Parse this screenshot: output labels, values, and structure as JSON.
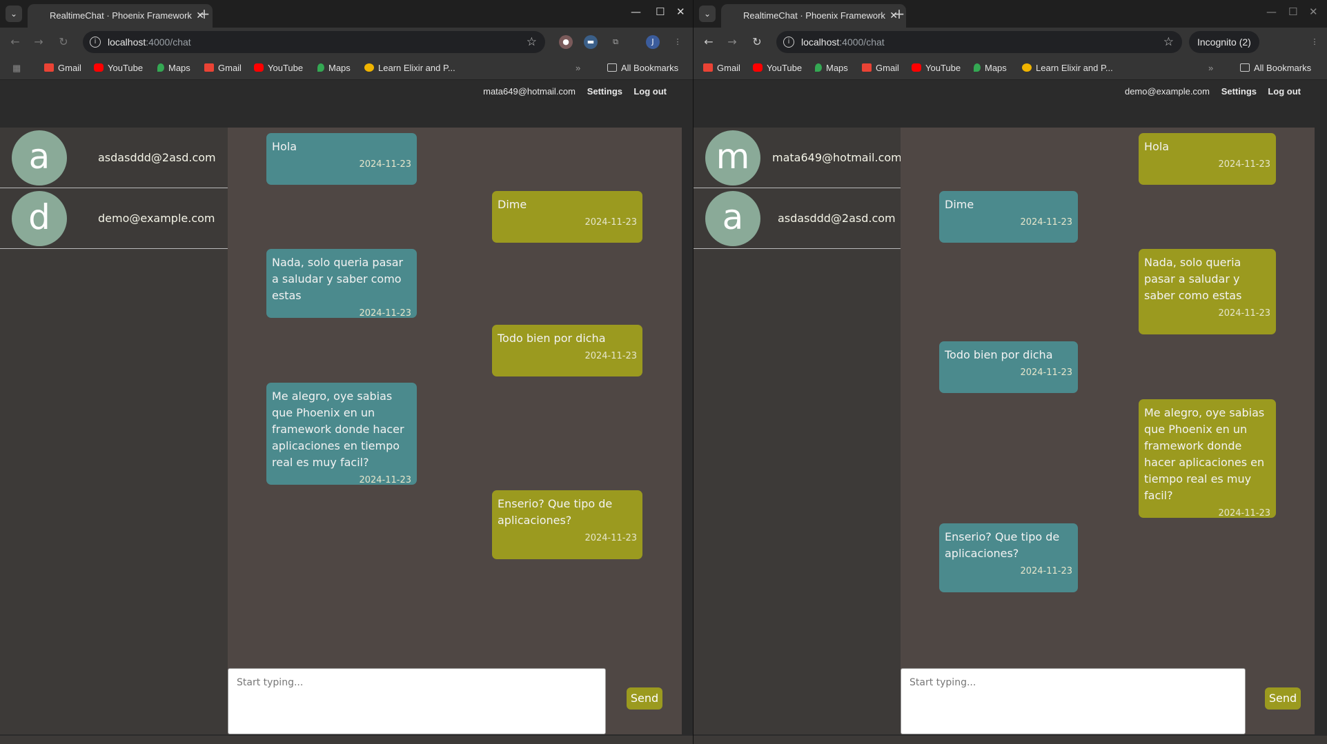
{
  "left": {
    "tab_title": "RealtimeChat · Phoenix Framework",
    "url_host": "localhost",
    "url_path": ":4000/chat",
    "profile_initial": "J",
    "bookmarks": [
      "Gmail",
      "YouTube",
      "Maps",
      "Gmail",
      "YouTube",
      "Maps",
      "Learn Elixir and P..."
    ],
    "all_bookmarks": "All Bookmarks",
    "user_email": "mata649@hotmail.com",
    "settings": "Settings",
    "logout": "Log out",
    "contacts": [
      {
        "initial": "a",
        "email": "asdasddd@2asd.com"
      },
      {
        "initial": "d",
        "email": "demo@example.com"
      }
    ],
    "messages": [
      {
        "text": "Hola",
        "date": "2024-11-23",
        "side": "left"
      },
      {
        "text": "Dime",
        "date": "2024-11-23",
        "side": "right"
      },
      {
        "text": "Nada, solo queria pasar a saludar y saber como estas",
        "date": "2024-11-23",
        "side": "left"
      },
      {
        "text": "Todo bien por dicha",
        "date": "2024-11-23",
        "side": "right"
      },
      {
        "text": "Me alegro, oye sabias que Phoenix en un framework donde hacer aplicaciones en tiempo real es muy facil?",
        "date": "2024-11-23",
        "side": "left"
      },
      {
        "text": "Enserio? Que tipo de aplicaciones?",
        "date": "2024-11-23",
        "side": "right"
      }
    ],
    "placeholder": "Start typing...",
    "send": "Send"
  },
  "right": {
    "tab_title": "RealtimeChat · Phoenix Framework",
    "url_host": "localhost",
    "url_path": ":4000/chat",
    "incognito": "Incognito (2)",
    "bookmarks": [
      "Gmail",
      "YouTube",
      "Maps",
      "Gmail",
      "YouTube",
      "Maps",
      "Learn Elixir and P..."
    ],
    "all_bookmarks": "All Bookmarks",
    "user_email": "demo@example.com",
    "settings": "Settings",
    "logout": "Log out",
    "contacts": [
      {
        "initial": "m",
        "email": "mata649@hotmail.com"
      },
      {
        "initial": "a",
        "email": "asdasddd@2asd.com"
      }
    ],
    "messages": [
      {
        "text": "Hola",
        "date": "2024-11-23",
        "side": "right"
      },
      {
        "text": "Dime",
        "date": "2024-11-23",
        "side": "left"
      },
      {
        "text": "Nada, solo queria pasar a saludar y saber como estas",
        "date": "2024-11-23",
        "side": "right"
      },
      {
        "text": "Todo bien por dicha",
        "date": "2024-11-23",
        "side": "left"
      },
      {
        "text": "Me alegro, oye sabias que Phoenix en un framework donde hacer aplicaciones en tiempo real es muy facil?",
        "date": "2024-11-23",
        "side": "right"
      },
      {
        "text": "Enserio? Que tipo de aplicaciones?",
        "date": "2024-11-23",
        "side": "left"
      }
    ],
    "placeholder": "Start typing...",
    "send": "Send"
  },
  "colors": {
    "teal_bubble": "#4b8a8d",
    "olive_bubble": "#9b9a1f",
    "avatar": "#8aaa98"
  }
}
